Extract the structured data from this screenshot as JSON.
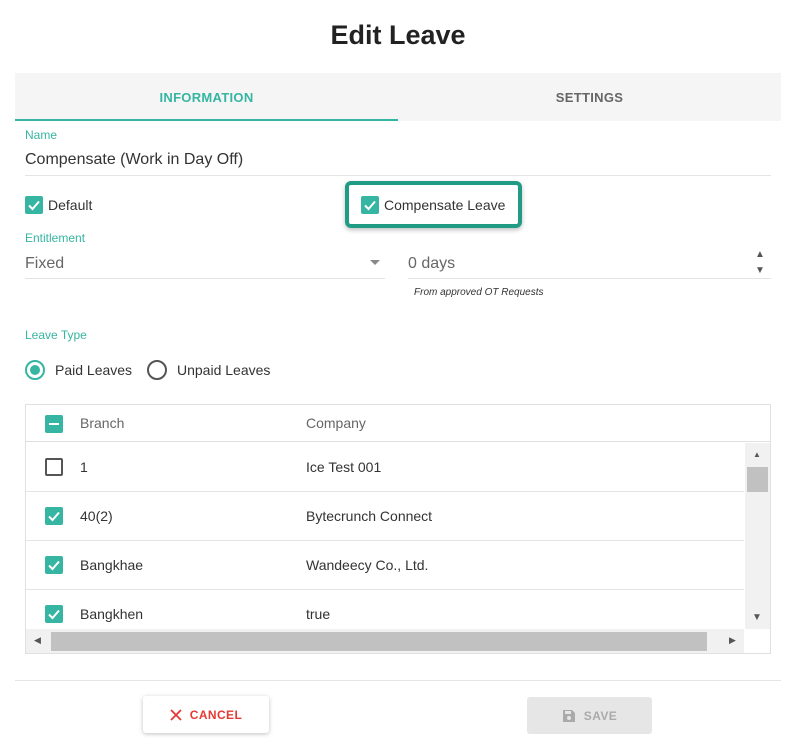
{
  "dialog": {
    "title": "Edit Leave"
  },
  "tabs": [
    {
      "label": "INFORMATION",
      "active": true
    },
    {
      "label": "SETTINGS",
      "active": false
    }
  ],
  "name_field": {
    "label": "Name",
    "value": "Compensate (Work in Day Off)"
  },
  "checkboxes": {
    "default": {
      "label": "Default",
      "checked": true
    },
    "compensate": {
      "label": "Compensate Leave",
      "checked": true
    }
  },
  "entitlement": {
    "label": "Entitlement",
    "type_value": "Fixed",
    "days_value": "0 days",
    "note": "From approved OT Requests"
  },
  "leave_type": {
    "label": "Leave Type",
    "options": [
      {
        "label": "Paid Leaves",
        "selected": true
      },
      {
        "label": "Unpaid Leaves",
        "selected": false
      }
    ]
  },
  "table": {
    "columns": [
      "Branch",
      "Company"
    ],
    "rows": [
      {
        "branch": "1",
        "company": "Ice Test 001",
        "checked": false
      },
      {
        "branch": "40(2)",
        "company": "Bytecrunch Connect",
        "checked": true
      },
      {
        "branch": "Bangkhae",
        "company": "Wandeecy Co., Ltd.",
        "checked": true
      },
      {
        "branch": "Bangkhen",
        "company": "true",
        "checked": true
      }
    ]
  },
  "footer": {
    "cancel_label": "CANCEL",
    "save_label": "SAVE"
  },
  "colors": {
    "accent": "#36b5a2",
    "highlight": "#1f9c83",
    "cancel": "#e53935"
  }
}
